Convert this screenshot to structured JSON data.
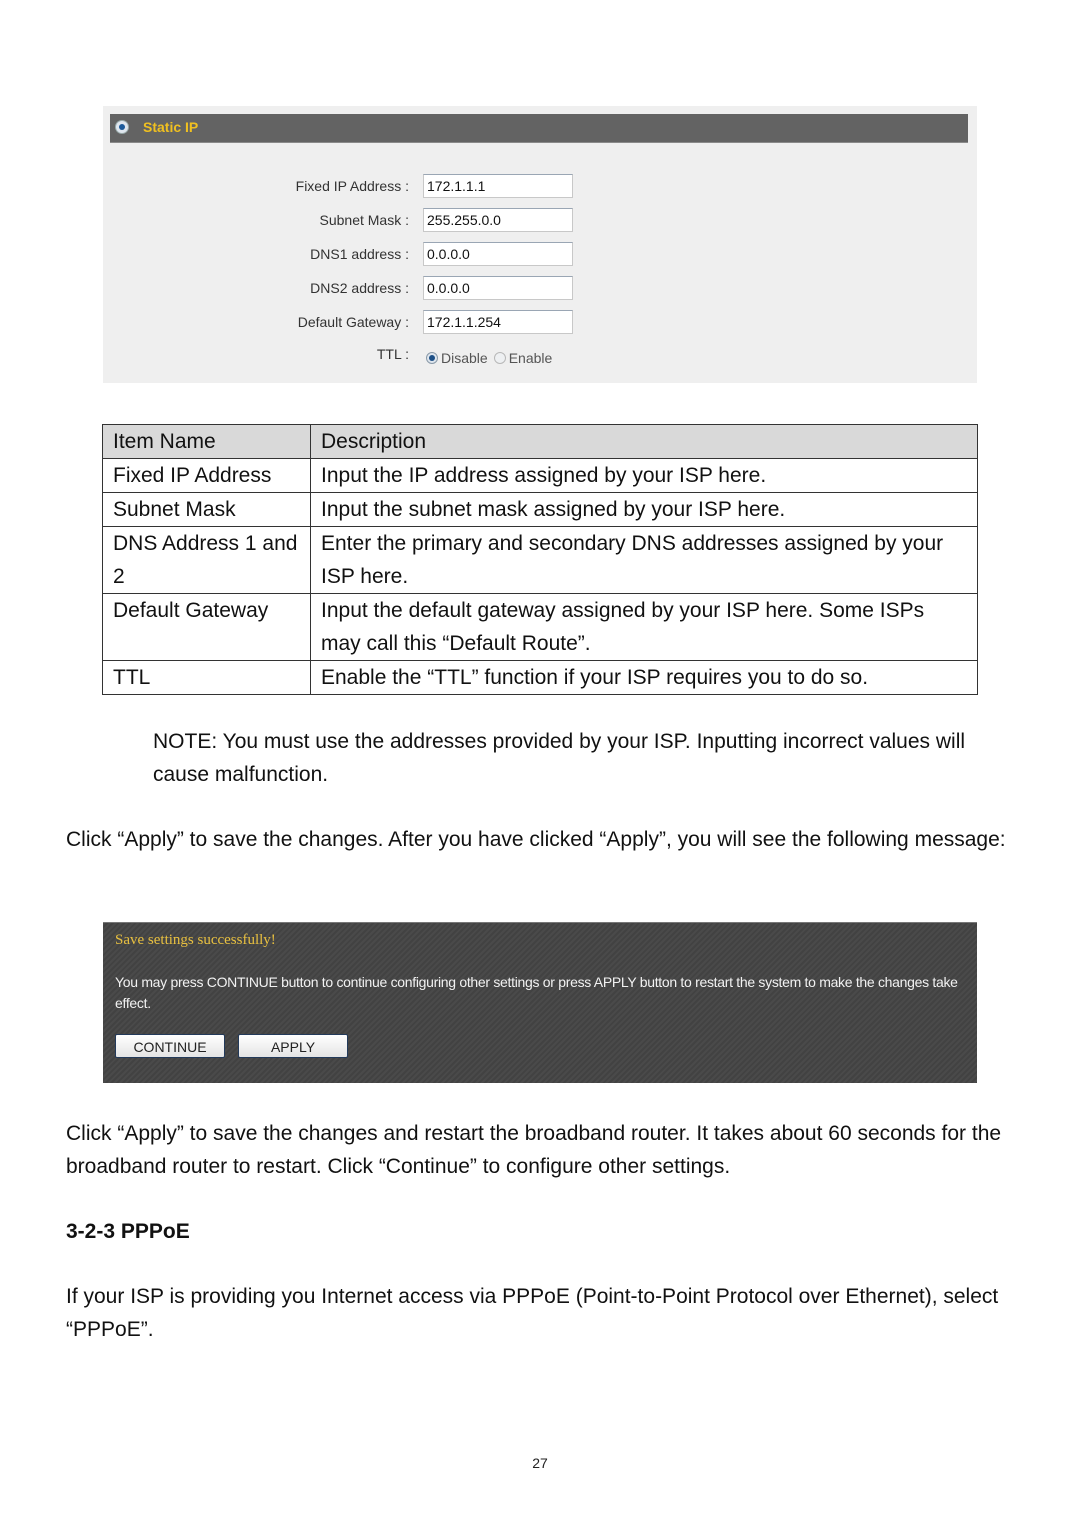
{
  "static_ip_panel": {
    "title": "Static IP",
    "fields": [
      {
        "label": "Fixed IP Address :",
        "value": "172.1.1.1"
      },
      {
        "label": "Subnet Mask :",
        "value": "255.255.0.0"
      },
      {
        "label": "DNS1 address :",
        "value": "0.0.0.0"
      },
      {
        "label": "DNS2 address :",
        "value": "0.0.0.0"
      },
      {
        "label": "Default Gateway :",
        "value": "172.1.1.254"
      }
    ],
    "ttl": {
      "label": "TTL :",
      "options": [
        "Disable",
        "Enable"
      ],
      "selected": "Disable"
    }
  },
  "table": {
    "headers": [
      "Item Name",
      "Description"
    ],
    "rows": [
      {
        "name": "Fixed IP Address",
        "description": "Input the IP address assigned by your ISP here."
      },
      {
        "name": "Subnet Mask",
        "description": "Input the subnet mask assigned by your ISP here."
      },
      {
        "name": "DNS Address 1 and 2",
        "description": "Enter the primary and secondary DNS addresses assigned by your ISP here."
      },
      {
        "name": "Default Gateway",
        "description": "Input the default gateway assigned by your ISP here. Some ISPs may call this “Default Route”."
      },
      {
        "name": "TTL",
        "description": "Enable the “TTL” function if your ISP requires you to do so."
      }
    ]
  },
  "note": "NOTE: You must use the addresses provided by your ISP. Inputting incorrect values will cause malfunction.",
  "paragraph_apply": "Click “Apply” to save the changes. After you have clicked “Apply”, you will see the following message:",
  "save_message": {
    "title": "Save settings successfully!",
    "body": "You may press CONTINUE button to continue configuring other settings or press APPLY button to restart the system to make the changes take effect.",
    "continue_label": "CONTINUE",
    "apply_label": "APPLY"
  },
  "paragraph_restart": "Click “Apply” to save the changes and restart the broadband router. It takes about 60 seconds for the broadband router to restart. Click “Continue” to configure other settings.",
  "section_heading": "3-2-3 PPPoE",
  "paragraph_pppoe": "If your ISP is providing you Internet access via PPPoE (Point-to-Point Protocol over Ethernet), select “PPPoE”.",
  "page_number": "27"
}
